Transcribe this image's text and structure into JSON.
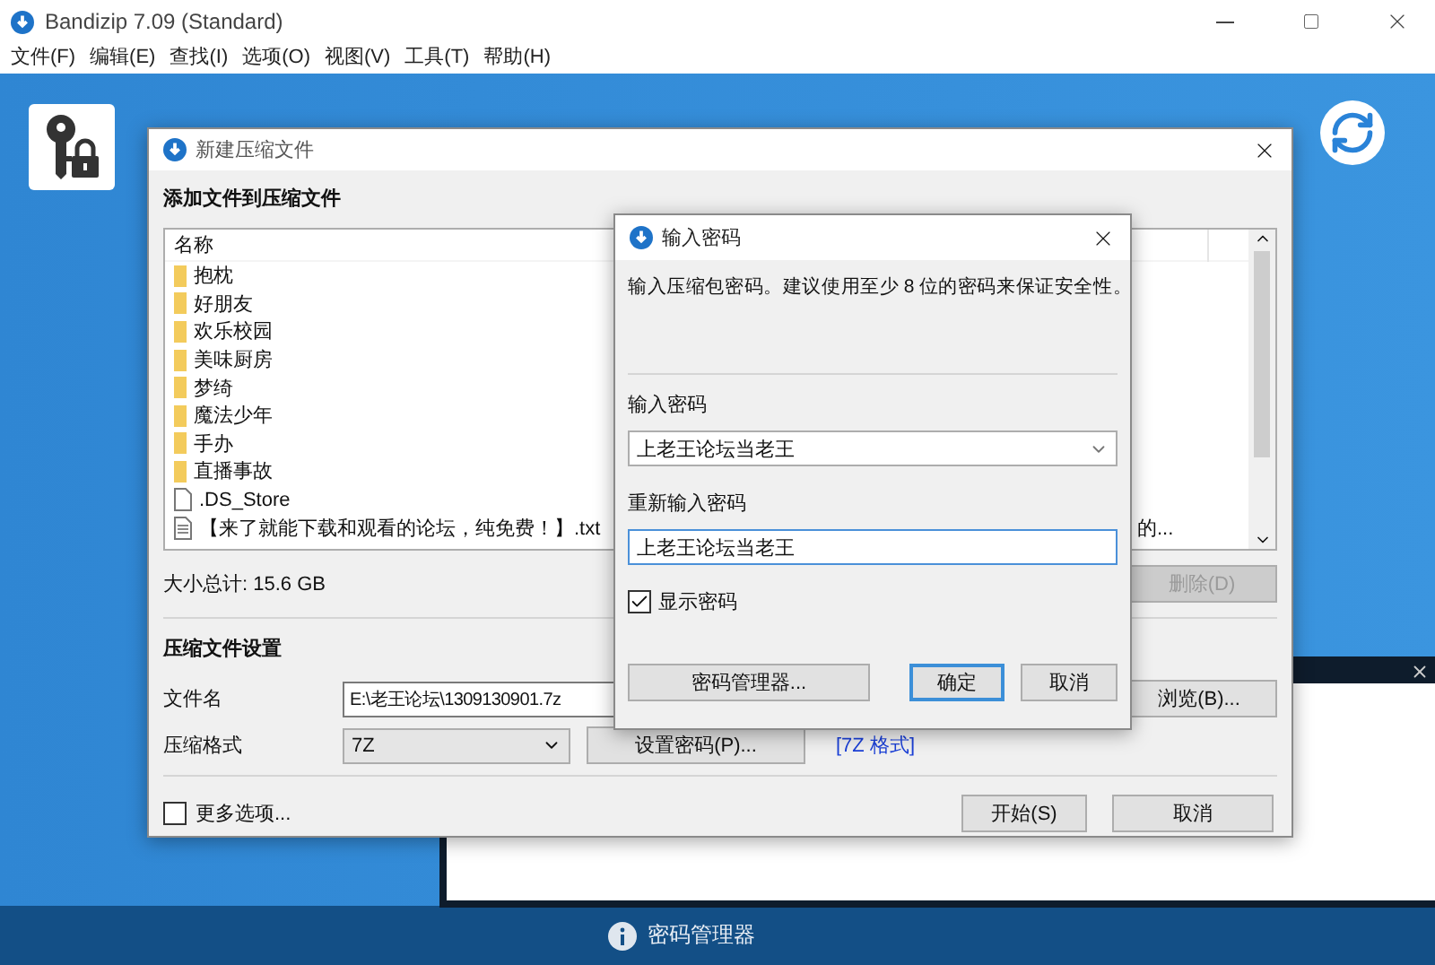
{
  "app": {
    "title": "Bandizip 7.09 (Standard)",
    "menu": [
      "文件(F)",
      "编辑(E)",
      "查找(I)",
      "选项(O)",
      "视图(V)",
      "工具(T)",
      "帮助(H)"
    ]
  },
  "archive_dialog": {
    "title": "新建压缩文件",
    "add_heading": "添加文件到压缩文件",
    "list": {
      "columns": [
        "名称"
      ],
      "rows": [
        {
          "kind": "folder",
          "name": "抱枕"
        },
        {
          "kind": "folder",
          "name": "好朋友"
        },
        {
          "kind": "folder",
          "name": "欢乐校园"
        },
        {
          "kind": "folder",
          "name": "美味厨房"
        },
        {
          "kind": "folder",
          "name": "梦绮"
        },
        {
          "kind": "folder",
          "name": "魔法少年"
        },
        {
          "kind": "folder",
          "name": "手办"
        },
        {
          "kind": "folder",
          "name": "直播事故"
        },
        {
          "kind": "file",
          "name": ".DS_Store"
        },
        {
          "kind": "text",
          "name": "【来了就能下载和观看的论坛，纯免费！】.txt",
          "name_tail": "的..."
        }
      ]
    },
    "total": "大小总计: 15.6 GB",
    "delete_button": {
      "label": "删除(D)",
      "disabled": true
    },
    "settings_heading": "压缩文件设置",
    "filename": {
      "label": "文件名",
      "value": "E:\\老王论坛\\1309130901.7z"
    },
    "browse_button": "浏览(B)...",
    "format": {
      "label": "压缩格式",
      "value": "7Z"
    },
    "password_button": "设置密码(P)...",
    "format_link": "[7Z 格式]",
    "more_options": {
      "label": "更多选项...",
      "checked": false
    },
    "start_button": "开始(S)",
    "cancel_button": "取消"
  },
  "password_dialog": {
    "title": "输入密码",
    "description": "输入压缩包密码。建议使用至少 8 位的密码来保证安全性。",
    "password": {
      "label": "输入密码",
      "value": "上老王论坛当老王"
    },
    "confirm": {
      "label": "重新输入密码",
      "value": "上老王论坛当老王"
    },
    "show_password": {
      "label": "显示密码",
      "checked": true
    },
    "buttons": [
      {
        "label": "密码管理器...",
        "kind": "wide"
      },
      {
        "label": "确定",
        "kind": "default"
      },
      {
        "label": "取消",
        "kind": "normal"
      }
    ]
  },
  "status_bar": {
    "text": "密码管理器"
  }
}
